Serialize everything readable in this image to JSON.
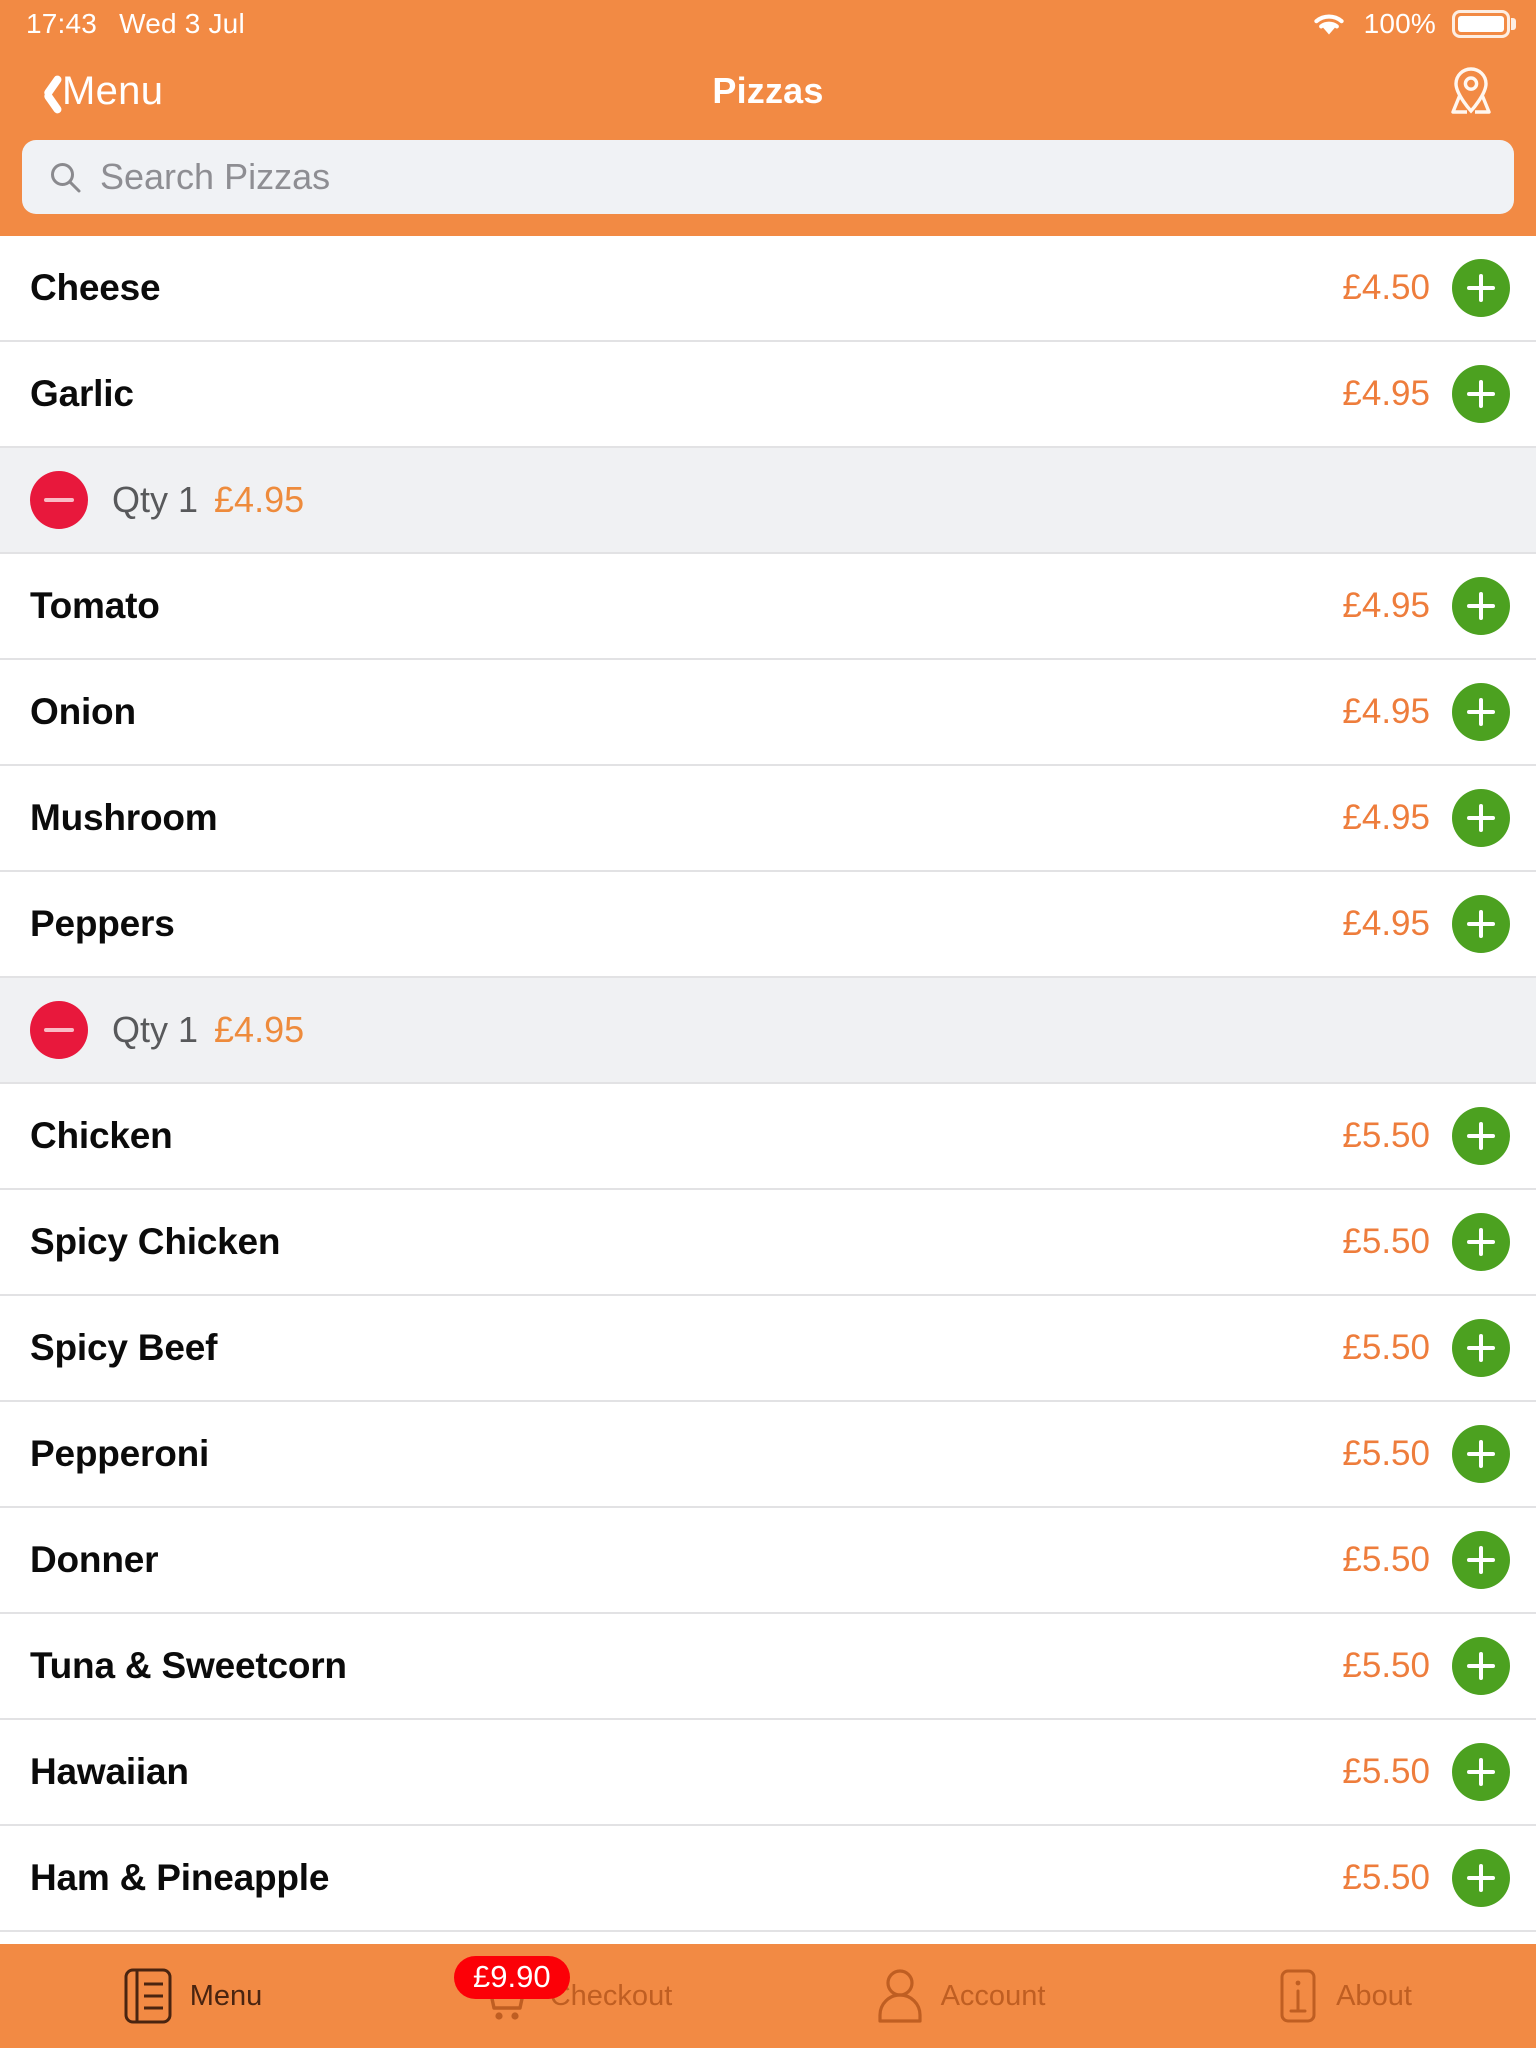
{
  "status_bar": {
    "time": "17:43",
    "date": "Wed 3 Jul",
    "battery_percent": "100%",
    "wifi_icon": "wifi-icon",
    "battery_icon": "battery-full-icon"
  },
  "nav": {
    "back_label": "Menu",
    "back_icon": "chevron-left-icon",
    "title": "Pizzas",
    "right_icon": "map-pin-icon"
  },
  "search": {
    "placeholder": "Search Pizzas",
    "value": "",
    "icon": "search-icon"
  },
  "colors": {
    "brand_orange": "#F28A44",
    "price_orange": "#EE7D3C",
    "add_green": "#4CA120",
    "remove_red": "#E8183C",
    "badge_red": "#FC0007",
    "qty_row_grey": "#F0F1F3",
    "search_field_grey": "#F0F2F5"
  },
  "list": [
    {
      "kind": "item",
      "name": "Cheese",
      "price": "£4.50",
      "add_icon": "plus-icon"
    },
    {
      "kind": "item",
      "name": "Garlic",
      "price": "£4.95",
      "add_icon": "plus-icon"
    },
    {
      "kind": "qty",
      "qty_label": "Qty 1",
      "price": "£4.95",
      "remove_icon": "minus-icon"
    },
    {
      "kind": "item",
      "name": "Tomato",
      "price": "£4.95",
      "add_icon": "plus-icon"
    },
    {
      "kind": "item",
      "name": "Onion",
      "price": "£4.95",
      "add_icon": "plus-icon"
    },
    {
      "kind": "item",
      "name": "Mushroom",
      "price": "£4.95",
      "add_icon": "plus-icon"
    },
    {
      "kind": "item",
      "name": "Peppers",
      "price": "£4.95",
      "add_icon": "plus-icon"
    },
    {
      "kind": "qty",
      "qty_label": "Qty 1",
      "price": "£4.95",
      "remove_icon": "minus-icon"
    },
    {
      "kind": "item",
      "name": "Chicken",
      "price": "£5.50",
      "add_icon": "plus-icon"
    },
    {
      "kind": "item",
      "name": "Spicy Chicken",
      "price": "£5.50",
      "add_icon": "plus-icon"
    },
    {
      "kind": "item",
      "name": "Spicy Beef",
      "price": "£5.50",
      "add_icon": "plus-icon"
    },
    {
      "kind": "item",
      "name": "Pepperoni",
      "price": "£5.50",
      "add_icon": "plus-icon"
    },
    {
      "kind": "item",
      "name": "Donner",
      "price": "£5.50",
      "add_icon": "plus-icon"
    },
    {
      "kind": "item",
      "name": "Tuna & Sweetcorn",
      "price": "£5.50",
      "add_icon": "plus-icon"
    },
    {
      "kind": "item",
      "name": "Hawaiian",
      "price": "£5.50",
      "add_icon": "plus-icon"
    },
    {
      "kind": "item",
      "name": "Ham & Pineapple",
      "price": "£5.50",
      "add_icon": "plus-icon"
    }
  ],
  "tabbar": [
    {
      "label": "Menu",
      "icon": "menu-book-icon",
      "active": true,
      "badge": ""
    },
    {
      "label": "Checkout",
      "icon": "shopping-cart-icon",
      "active": false,
      "badge": "£9.90"
    },
    {
      "label": "Account",
      "icon": "person-icon",
      "active": false,
      "badge": ""
    },
    {
      "label": "About",
      "icon": "info-icon",
      "active": false,
      "badge": ""
    }
  ]
}
